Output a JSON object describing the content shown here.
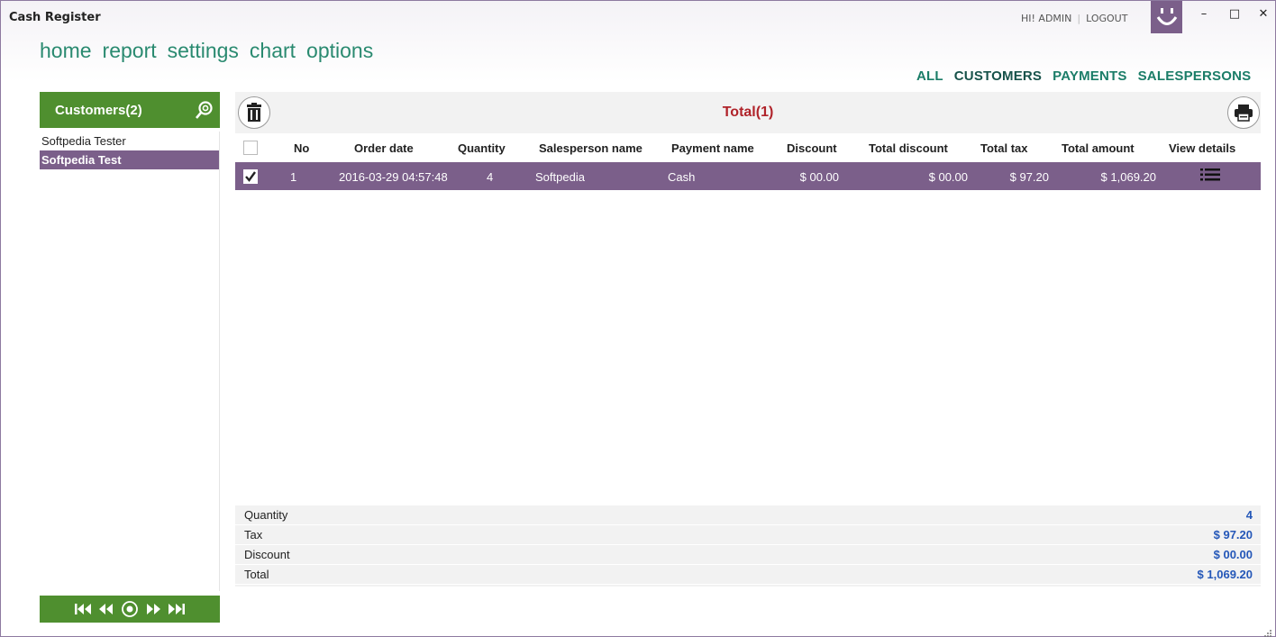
{
  "window": {
    "title": "Cash Register"
  },
  "user": {
    "greeting": "HI! ADMIN",
    "separator": "|",
    "logout": "LOGOUT"
  },
  "window_controls": {
    "minimize": "–",
    "maximize": "□",
    "close": "✕"
  },
  "main_nav": [
    "home",
    "report",
    "settings",
    "chart",
    "options"
  ],
  "filter_nav": {
    "items": [
      "ALL",
      "CUSTOMERS",
      "PAYMENTS",
      "SALESPERSONS"
    ],
    "active": "CUSTOMERS"
  },
  "customers": {
    "header": "Customers(2)",
    "items": [
      {
        "name": "Softpedia Tester",
        "selected": false
      },
      {
        "name": "Softpedia Test",
        "selected": true
      }
    ]
  },
  "grid": {
    "title": "Total(1)",
    "columns": [
      "No",
      "Order date",
      "Quantity",
      "Salesperson name",
      "Payment name",
      "Discount",
      "Total discount",
      "Total tax",
      "Total amount",
      "View details"
    ],
    "rows": [
      {
        "checked": true,
        "no": "1",
        "order_date": "2016-03-29 04:57:48",
        "quantity": "4",
        "salesperson": "Softpedia",
        "payment": "Cash",
        "discount": "$ 00.00",
        "total_discount": "$ 00.00",
        "total_tax": "$ 97.20",
        "total_amount": "$ 1,069.20"
      }
    ]
  },
  "summary": {
    "quantity_label": "Quantity",
    "quantity_value": "4",
    "tax_label": "Tax",
    "tax_value": "$ 97.20",
    "discount_label": "Discount",
    "discount_value": "$ 00.00",
    "total_label": "Total",
    "total_value": "$ 1,069.20"
  },
  "colors": {
    "accent_green": "#4f8f2f",
    "accent_purple": "#7b5f8a",
    "nav_teal": "#2a8a70",
    "total_red": "#b0232a",
    "summary_blue": "#2457b8"
  },
  "icons": {
    "smiley": "smiley-icon",
    "search": "search-icon",
    "trash": "trash-icon",
    "print": "printer-icon",
    "details": "list-icon",
    "pager": [
      "first-page-icon",
      "previous-page-icon",
      "current-page-icon",
      "next-page-icon",
      "last-page-icon"
    ]
  }
}
